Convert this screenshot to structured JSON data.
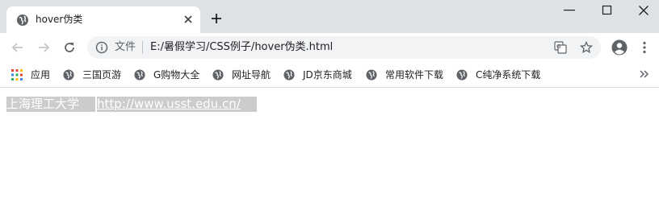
{
  "tab": {
    "title": "hover伪类"
  },
  "omnibox": {
    "scheme_label": "文件",
    "url": "E:/暑假学习/CSS例子/hover伪类.html"
  },
  "bookmarks": [
    {
      "label": "应用",
      "icon": "apps-grid-icon"
    },
    {
      "label": "三国页游",
      "icon": "globe-icon"
    },
    {
      "label": "G购物大全",
      "icon": "globe-icon"
    },
    {
      "label": "网址导航",
      "icon": "globe-icon"
    },
    {
      "label": "JD京东商城",
      "icon": "globe-icon"
    },
    {
      "label": "常用软件下载",
      "icon": "globe-icon"
    },
    {
      "label": "C纯净系统下载",
      "icon": "globe-icon"
    }
  ],
  "page": {
    "links": [
      {
        "text": "上海理工大学"
      },
      {
        "text": "http://www.usst.edu.cn/"
      }
    ]
  },
  "colors": {
    "tabstrip": "#dee1e6",
    "omnibox": "#f1f3f4",
    "link_background": "#cccccc",
    "link_text": "#ffffff"
  }
}
